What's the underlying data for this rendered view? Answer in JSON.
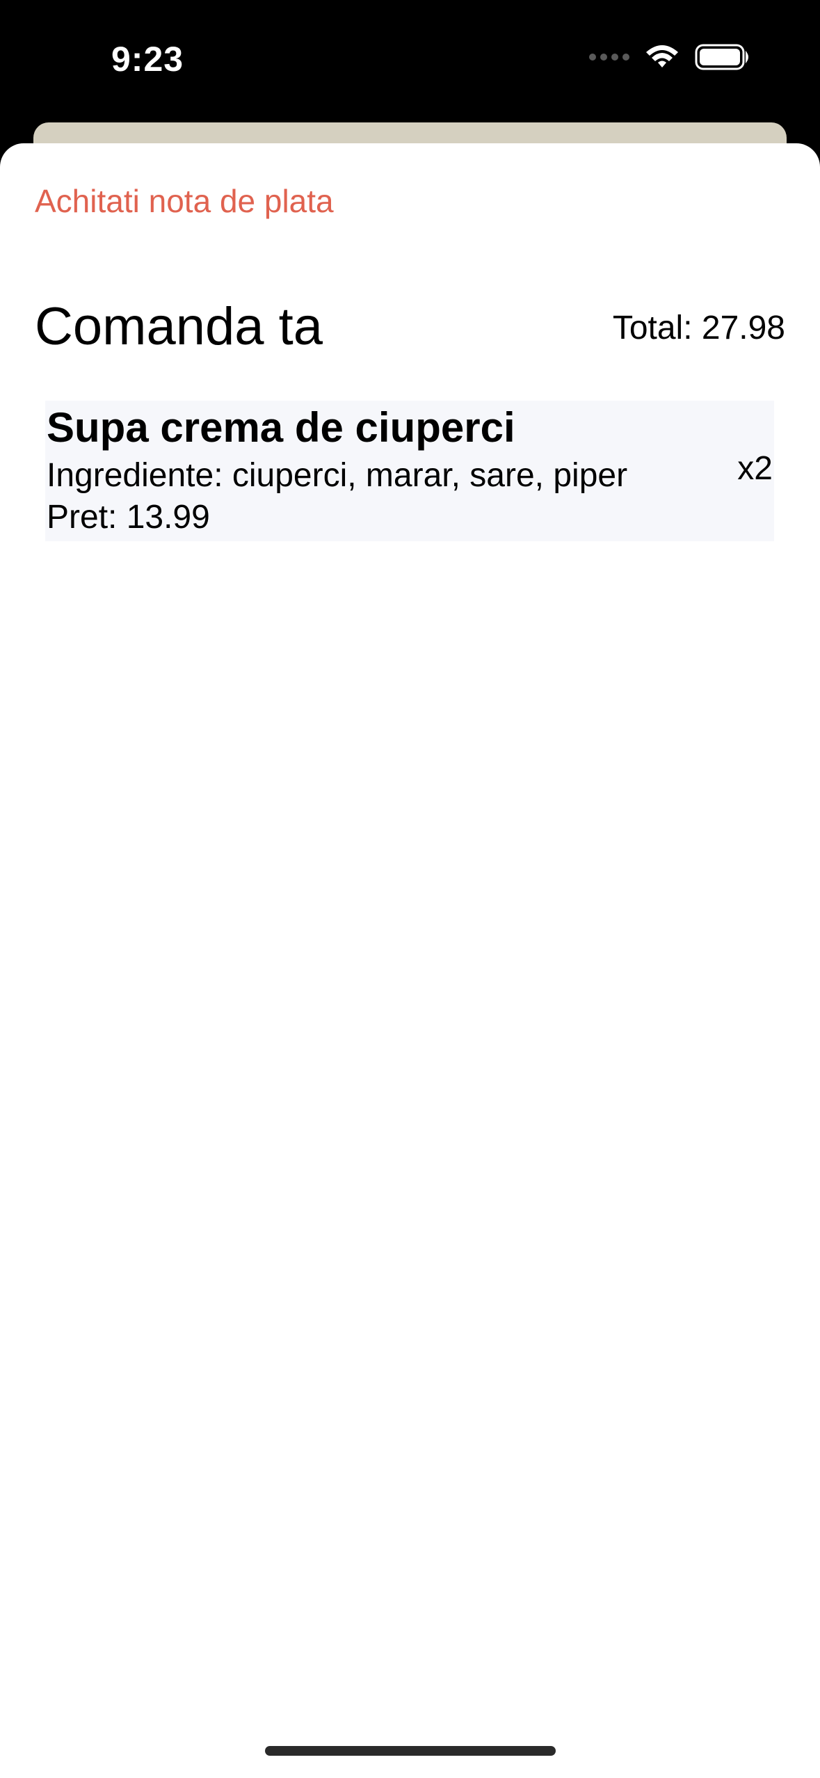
{
  "status_bar": {
    "time": "9:23"
  },
  "header": {
    "pay_link": "Achitati nota de plata"
  },
  "order": {
    "title": "Comanda ta",
    "total": "Total: 27.98",
    "items": [
      {
        "name": "Supa crema de ciuperci",
        "ingredients": "Ingrediente: ciuperci, marar, sare, piper",
        "price": "Pret: 13.99",
        "quantity": "x2"
      }
    ]
  },
  "colors": {
    "accent": "#e0624f",
    "sheet_background": "#ffffff",
    "item_background": "#f6f7fb",
    "sheet_behind": "#d5d0c0"
  }
}
